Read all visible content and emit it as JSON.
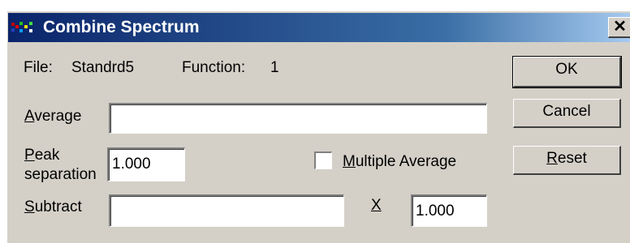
{
  "window": {
    "title": "Combine Spectrum",
    "close_glyph": "✕"
  },
  "info": {
    "file_label": "File:",
    "file_value": "Standrd5",
    "function_label": "Function:",
    "function_value": "1"
  },
  "average": {
    "label_key": "A",
    "label_rest": "verage",
    "value": ""
  },
  "peak_separation": {
    "label_key": "P",
    "label_line1_rest": "eak",
    "label_line2": "separation",
    "value": "1.000"
  },
  "multiple_average": {
    "label_key": "M",
    "label_rest": "ultiple Average",
    "checked": false
  },
  "subtract": {
    "label_key": "S",
    "label_rest": "ubtract",
    "value": ""
  },
  "multiplier": {
    "label": "X",
    "value": "1.000"
  },
  "buttons": {
    "ok": "OK",
    "cancel": "Cancel",
    "reset_key": "R",
    "reset_rest": "eset"
  }
}
